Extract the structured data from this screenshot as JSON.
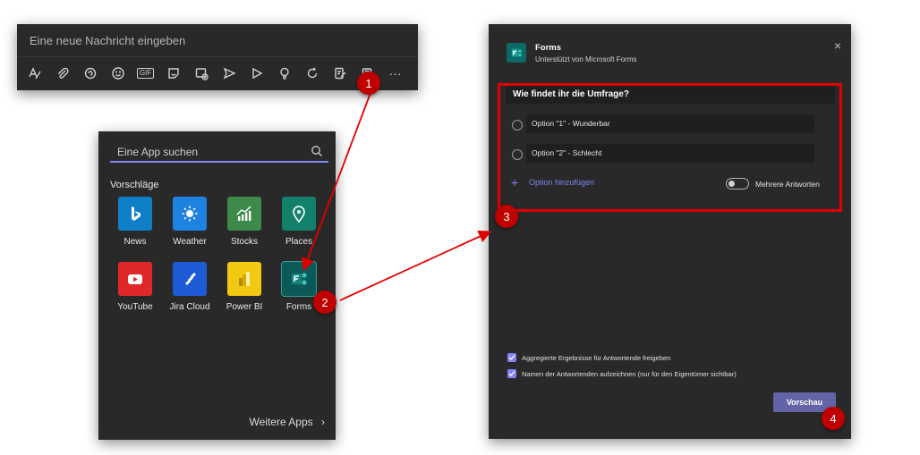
{
  "compose": {
    "placeholder": "Eine neue Nachricht eingeben",
    "toolbar": [
      {
        "icon": "format-icon"
      },
      {
        "icon": "attach-icon"
      },
      {
        "icon": "loop-icon"
      },
      {
        "icon": "emoji-icon"
      },
      {
        "icon": "gif-icon",
        "label": "GIF"
      },
      {
        "icon": "sticker-icon"
      },
      {
        "icon": "schedule-meeting-icon"
      },
      {
        "icon": "send-icon"
      },
      {
        "icon": "stream-icon"
      },
      {
        "icon": "praise-icon"
      },
      {
        "icon": "loop-refresh-icon"
      },
      {
        "icon": "approvals-icon"
      },
      {
        "icon": "forms-icon"
      },
      {
        "icon": "more-icon",
        "label": "···"
      }
    ]
  },
  "picker": {
    "search_placeholder": "Eine App suchen",
    "section_title": "Vorschläge",
    "apps": [
      {
        "name": "News",
        "icon": "bing-news-icon",
        "color": "#0f7fc7"
      },
      {
        "name": "Weather",
        "icon": "weather-icon",
        "color": "#1e83e0"
      },
      {
        "name": "Stocks",
        "icon": "stocks-icon",
        "color": "#3d8a4a"
      },
      {
        "name": "Places",
        "icon": "places-icon",
        "color": "#12806a"
      },
      {
        "name": "YouTube",
        "icon": "youtube-icon",
        "color": "#e0282a"
      },
      {
        "name": "Jira Cloud",
        "icon": "jira-icon",
        "color": "#1e5bd6"
      },
      {
        "name": "Power BI",
        "icon": "powerbi-icon",
        "color": "#f2c811"
      },
      {
        "name": "Forms",
        "icon": "forms-icon",
        "color": "#0b5a58"
      }
    ],
    "more_apps": "Weitere Apps",
    "more_chevron": "›"
  },
  "dialog": {
    "title": "Forms",
    "subtitle": "Unterstützt von Microsoft Forms",
    "close": "×",
    "question": "Wie findet ihr die Umfrage?",
    "options": [
      "Option \"1\" - Wunderbar",
      "Option \"2\" - Schlecht"
    ],
    "add_option": "Option hinzufügen",
    "add_plus": "+",
    "multiple_answers": "Mehrere Antworten",
    "checkboxes": [
      "Aggregierte Ergebnisse für Antwortende freigeben",
      "Namen der Antwortenden aufzeichnen (nur für den Eigentümer sichtbar)"
    ],
    "preview_button": "Vorschau"
  },
  "callouts": [
    "1",
    "2",
    "3",
    "4"
  ],
  "colors": {
    "callout": "#c00000",
    "accent": "#7f85f5",
    "panel": "#292929"
  }
}
